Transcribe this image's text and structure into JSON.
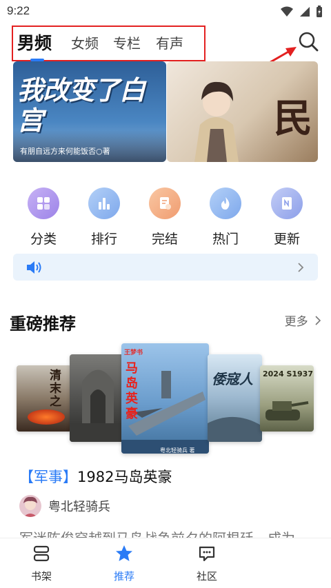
{
  "status_bar": {
    "time": "9:22"
  },
  "tabs": [
    {
      "label": "男频",
      "active": true
    },
    {
      "label": "女频",
      "active": false
    },
    {
      "label": "专栏",
      "active": false
    },
    {
      "label": "有声",
      "active": false
    }
  ],
  "banners": {
    "left_title": "我改变了白宫",
    "left_subtitle": "有朋自远方来何能饭否○著",
    "right_title": "民"
  },
  "categories": [
    {
      "label": "分类",
      "icon": "grid-icon",
      "color": "#b89df0"
    },
    {
      "label": "排行",
      "icon": "chart-icon",
      "color": "#8fb8f2"
    },
    {
      "label": "完结",
      "icon": "document-check-icon",
      "color": "#f6b48a"
    },
    {
      "label": "热门",
      "icon": "flame-icon",
      "color": "#8fb8f2"
    },
    {
      "label": "更新",
      "icon": "book-icon",
      "color": "#9eb0ee"
    }
  ],
  "section": {
    "title": "重磅推荐",
    "more": "更多"
  },
  "covers": {
    "c1": "清末之",
    "c3_top": "王梦书",
    "c3_title": "马岛英豪",
    "c3_author": "粤北轻骑兵 著",
    "c4": "倭寇人",
    "c5": "2024 S1937"
  },
  "featured_book": {
    "tag": "【军事】",
    "title": "1982马岛英豪",
    "author": "粤北轻骑兵",
    "description_fragment": "军迷陈俊穿越到马岛战争前夕的阿根廷，成为"
  },
  "bottom_nav": [
    {
      "label": "书架",
      "icon": "bookshelf-icon",
      "active": false
    },
    {
      "label": "推荐",
      "icon": "star-icon",
      "active": true
    },
    {
      "label": "社区",
      "icon": "chat-icon",
      "active": false
    }
  ],
  "colors": {
    "accent": "#2a7bf6",
    "highlight_box": "#e32020"
  }
}
